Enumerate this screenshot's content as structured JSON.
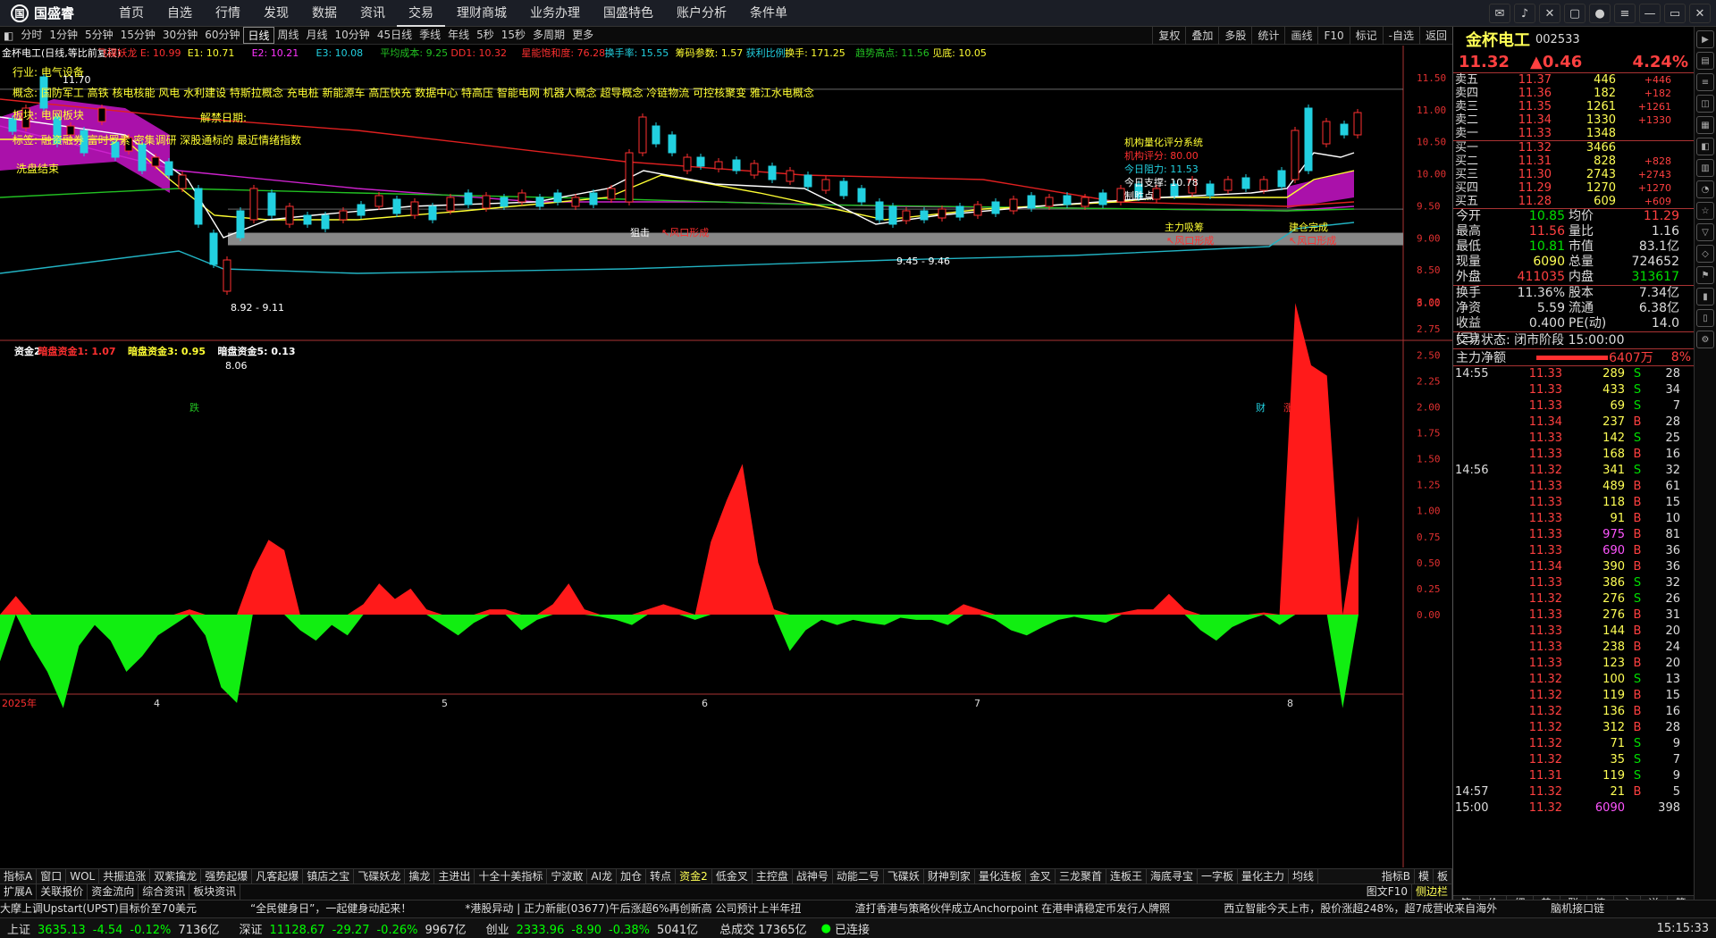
{
  "app": {
    "logo": "国盛睿",
    "nav": [
      "首页",
      "自选",
      "行情",
      "发现",
      "数据",
      "资讯",
      "交易",
      "理财商城",
      "业务办理",
      "国盛特色",
      "账户分析",
      "条件单"
    ],
    "active_nav": 6
  },
  "periods": [
    "分时",
    "1分钟",
    "5分钟",
    "15分钟",
    "30分钟",
    "60分钟",
    "日线",
    "周线",
    "月线",
    "10分钟",
    "45日线",
    "季线",
    "年线",
    "5秒",
    "15秒",
    "多周期",
    "更多"
  ],
  "active_period": 6,
  "tools": [
    "复权",
    "叠加",
    "多股",
    "统计",
    "画线",
    "F10",
    "标记",
    "-自选",
    "返回"
  ],
  "main_chart": {
    "legend": [
      "金杯电工(日线,等比前复权)",
      "飞碟妖龙 E: 10.99",
      "E1: 10.71",
      "E2: 10.21",
      "E3: 10.08",
      "平均成本: 9.25",
      "DD1: 10.32",
      "星能饱和度: 76.28",
      "换手率: 15.55",
      "筹码参数: 1.57",
      "获利比例:",
      "换手: 171.25",
      "趋势高点: 11.56",
      "见底: 10.05"
    ],
    "industry": "行业: 电气设备",
    "concepts": "概念: 国防军工 高铁 核电核能 风电 水利建设 特斯拉概念 充电桩 新能源车 高压快充 数据中心 特高压 智能电网 机器人概念 超导概念 冷链物流 可控核聚变 雅江水电概念",
    "sector": "板块: 电网板块",
    "tags": "标签: 融资融券 富时罗素 密集调研 深股通标的 最近情绪指数",
    "xipan": "洗盘结束",
    "jiejin": "解禁日期:",
    "yaxis": [
      "11.50",
      "11.00",
      "10.50",
      "10.00",
      "9.50",
      "9.00",
      "8.50",
      "8.00"
    ],
    "notes": {
      "low": "8.06",
      "zone": "8.92 - 9.11",
      "zone2": "9.45 - 9.46",
      "feng1": "↖风口形成",
      "feng2": "↖风口形成",
      "feng3": "↖风口形成",
      "zhuli": "主力吸筹",
      "jiancang": "建仓完成",
      "jigou": "机构量化评分系统",
      "jigou_score": "机构评分: 80.00",
      "zuli": "今日阻力: 11.53",
      "zhicheng": "今日支撑: 10.78",
      "zhisheng": "制胜点",
      "top": "11.70",
      "jiji": "狙击",
      "cai": "财",
      "zhangting": "涨榜",
      "die": "跌"
    }
  },
  "sub_chart": {
    "legend": [
      "资金2",
      "暗盘资金1: 1.07",
      "暗盘资金3: 0.95",
      "暗盘资金5: 0.13"
    ],
    "yaxis": [
      "3.00",
      "2.75",
      "2.50",
      "2.25",
      "2.00",
      "1.75",
      "1.50",
      "1.25",
      "1.00",
      "0.75",
      "0.50",
      "0.25",
      "0.00"
    ],
    "xlabels": [
      "2025年",
      "4",
      "5",
      "6",
      "7",
      "8"
    ]
  },
  "chart_data": {
    "type": "bar",
    "title": "暗盘资金",
    "values": [
      -0.45,
      0.18,
      -0.3,
      -0.55,
      -0.9,
      -0.3,
      -0.1,
      -0.25,
      -0.55,
      -0.4,
      -0.2,
      -0.1,
      0.05,
      -0.2,
      -0.7,
      -0.85,
      0.42,
      0.72,
      0.62,
      -0.15,
      -0.25,
      -0.1,
      -0.2,
      0.1,
      0.3,
      0.15,
      0.25,
      0.05,
      -0.1,
      -0.2,
      -0.08,
      0.05,
      0.05,
      -0.15,
      -0.05,
      0.1,
      0.3,
      0.05,
      -0.02,
      -0.05,
      -0.1,
      0.05,
      0.1,
      0.05,
      -0.05,
      0.7,
      1.1,
      1.45,
      0.5,
      0.05,
      -0.35,
      -0.15,
      -0.05,
      -0.1,
      -0.05,
      -0.08,
      -0.1,
      -0.03,
      -0.05,
      -0.05,
      -0.1,
      0.1,
      0.05,
      -0.05,
      -0.15,
      -0.2,
      -0.12,
      -0.05,
      -0.02,
      -0.05,
      -0.08,
      0.02,
      0.05,
      0.05,
      0.2,
      0.05,
      -0.15,
      -0.25,
      -0.12,
      -0.05,
      0.02,
      -0.1,
      3.0,
      2.4,
      2.3,
      -0.9,
      0.95
    ],
    "ylim": [
      -1.0,
      3.1
    ]
  },
  "quote": {
    "name": "金杯电工",
    "code": "002533",
    "price": "11.32",
    "change": "0.46",
    "pct": "4.24%",
    "asks": [
      {
        "l": "卖五",
        "p": "11.37",
        "v": "446",
        "c": "+446"
      },
      {
        "l": "卖四",
        "p": "11.36",
        "v": "182",
        "c": "+182"
      },
      {
        "l": "卖三",
        "p": "11.35",
        "v": "1261",
        "c": "+1261"
      },
      {
        "l": "卖二",
        "p": "11.34",
        "v": "1330",
        "c": "+1330"
      },
      {
        "l": "卖一",
        "p": "11.33",
        "v": "1348",
        "c": ""
      }
    ],
    "bids": [
      {
        "l": "买一",
        "p": "11.32",
        "v": "3466",
        "c": ""
      },
      {
        "l": "买二",
        "p": "11.31",
        "v": "828",
        "c": "+828"
      },
      {
        "l": "买三",
        "p": "11.30",
        "v": "2743",
        "c": "+2743"
      },
      {
        "l": "买四",
        "p": "11.29",
        "v": "1270",
        "c": "+1270"
      },
      {
        "l": "买五",
        "p": "11.28",
        "v": "609",
        "c": "+609"
      }
    ],
    "info": [
      [
        "今开",
        "10.85",
        "均价",
        "11.29"
      ],
      [
        "最高",
        "11.56",
        "量比",
        "1.16"
      ],
      [
        "最低",
        "10.81",
        "市值",
        "83.1亿"
      ],
      [
        "现量",
        "6090",
        "总量",
        "724652"
      ],
      [
        "外盘",
        "411035",
        "内盘",
        "313617"
      ]
    ],
    "info2": [
      [
        "换手",
        "11.36%",
        "股本",
        "7.34亿"
      ],
      [
        "净资",
        "5.59",
        "流通",
        "6.38亿"
      ],
      [
        "收益(三)",
        "0.400",
        "PE(动)",
        "14.0"
      ]
    ],
    "status": "交易状态: 闭市阶段 15:00:00",
    "zhuli": "主力净额",
    "zhuli_val": "6407万",
    "zhuli_pct": "8%",
    "ticks": [
      [
        "14:55",
        "11.33",
        "289",
        "S",
        "28"
      ],
      [
        "",
        "11.33",
        "433",
        "S",
        "34"
      ],
      [
        "",
        "11.33",
        "69",
        "S",
        "7"
      ],
      [
        "",
        "11.34",
        "237",
        "B",
        "28"
      ],
      [
        "",
        "11.33",
        "142",
        "S",
        "25"
      ],
      [
        "",
        "11.33",
        "168",
        "B",
        "16"
      ],
      [
        "14:56",
        "11.32",
        "341",
        "S",
        "32"
      ],
      [
        "",
        "11.33",
        "489",
        "B",
        "61"
      ],
      [
        "",
        "11.33",
        "118",
        "B",
        "15"
      ],
      [
        "",
        "11.33",
        "91",
        "B",
        "10"
      ],
      [
        "",
        "11.33",
        "975",
        "B",
        "81"
      ],
      [
        "",
        "11.33",
        "690",
        "B",
        "36"
      ],
      [
        "",
        "11.34",
        "390",
        "B",
        "36"
      ],
      [
        "",
        "11.33",
        "386",
        "S",
        "32"
      ],
      [
        "",
        "11.32",
        "276",
        "S",
        "26"
      ],
      [
        "",
        "11.33",
        "276",
        "B",
        "31"
      ],
      [
        "",
        "11.33",
        "144",
        "B",
        "20"
      ],
      [
        "",
        "11.33",
        "238",
        "B",
        "24"
      ],
      [
        "",
        "11.33",
        "123",
        "B",
        "20"
      ],
      [
        "",
        "11.32",
        "100",
        "S",
        "13"
      ],
      [
        "",
        "11.32",
        "119",
        "B",
        "15"
      ],
      [
        "",
        "11.32",
        "136",
        "B",
        "16"
      ],
      [
        "",
        "11.32",
        "312",
        "B",
        "28"
      ],
      [
        "",
        "11.32",
        "71",
        "S",
        "9"
      ],
      [
        "",
        "11.32",
        "35",
        "S",
        "7"
      ],
      [
        "",
        "11.31",
        "119",
        "S",
        "9"
      ],
      [
        "14:57",
        "11.32",
        "21",
        "B",
        "5"
      ],
      [
        "15:00",
        "11.32",
        "6090",
        "",
        "398"
      ]
    ],
    "bottom_tabs": [
      "笔",
      "价",
      "细",
      "势",
      "联",
      "值",
      "主",
      "逆",
      "筹"
    ]
  },
  "tabs": [
    "指标A",
    "窗口",
    "WOL",
    "共振追涨",
    "双紫擒龙",
    "强势起爆",
    "凡客起爆",
    "镇店之宝",
    "飞碟妖龙",
    "擒龙",
    "主进出",
    "十全十美指标",
    "宁波敢",
    "AI龙",
    "加仓",
    "转点",
    "资金2",
    "低金叉",
    "主控盘",
    "战神号",
    "动能二号",
    "飞碟妖",
    "财神到家",
    "量化连板",
    "金叉",
    "三龙聚首",
    "连板王",
    "海底寻宝",
    "一字板",
    "量化主力",
    "均线"
  ],
  "active_tab": 16,
  "tab_right": [
    "指标B",
    "模",
    "板"
  ],
  "sub_tabs": [
    "扩展A",
    "关联报价",
    "资金流向",
    "综合资讯",
    "板块资讯"
  ],
  "sub_tabs_right": [
    "图文F10",
    "侧边栏"
  ],
  "news": [
    "大摩上调Upstart(UPST)目标价至70美元",
    "“全民健身日”，一起健身动起来！",
    "*港股异动 | 正力新能(03677)午后涨超6%再创新高 公司预计上半年扭",
    "渣打香港与策略伙伴成立Anchorpoint 在港申请稳定币发行人牌照",
    "西立智能今天上市，股价涨超248%，超7成营收来自海外",
    "脑机接口链"
  ],
  "indices": [
    [
      "上证",
      "3635.13",
      "-4.54",
      "-0.12%",
      "7136亿"
    ],
    [
      "深证",
      "11128.67",
      "-29.27",
      "-0.26%",
      "9967亿"
    ],
    [
      "创业",
      "2333.96",
      "-8.90",
      "-0.38%",
      "5041亿"
    ]
  ],
  "total": "总成交 17365亿",
  "connected": "已连接",
  "clock": "15:15:33",
  "colors": {
    "up": "#ff3030",
    "down": "#00e000",
    "accent": "#ffff55",
    "bg": "#000000"
  }
}
